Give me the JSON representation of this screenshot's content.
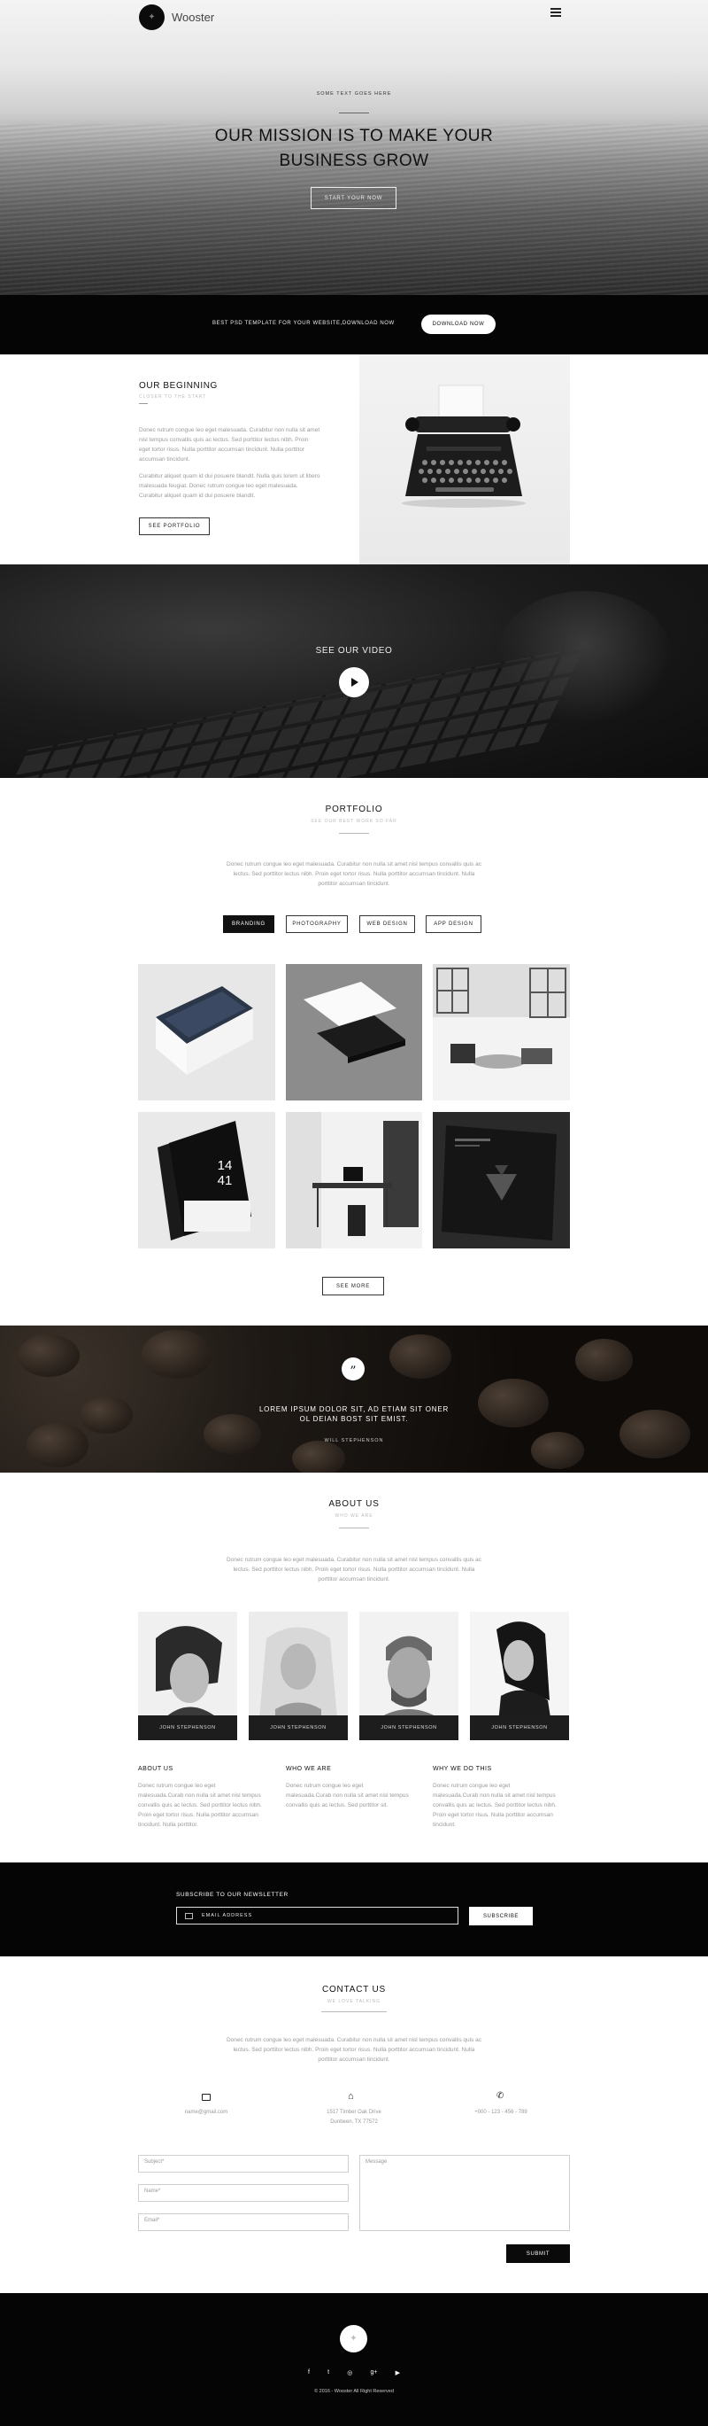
{
  "header": {
    "brand": "Wooster"
  },
  "hero": {
    "kicker": "SOME TEXT GOES HERE",
    "title_line1": "OUR MISSION IS TO MAKE YOUR",
    "title_line2": "BUSINESS GROW",
    "cta": "START YOUR NOW"
  },
  "promo": {
    "text": "BEST PSD TEMPLATE FOR YOUR WEBSITE,DOWNLOAD NOW",
    "button": "DOWNLOAD NOW"
  },
  "beginning": {
    "title": "OUR BEGINNING",
    "subtitle": "CLOSER TO THE START",
    "para1": "Donec rutrum congue leo eget malesuada. Curabitur non nulla sit amet nisl tempus convallis quis ac lectus. Sed porttitor lectus nibh. Proin eget tortor risus. Nulla porttitor accumsan tincidunt. Nulla porttitor accumsan tincidunt.",
    "para2": "Curabitur aliquet quam id dui posuere blandit. Nulla quis lorem ut libero malesuada feugiat. Donec rutrum congue leo eget malesuada. Curabitur aliquet quam id dui posuere blandit.",
    "button": "SEE PORTFOLIO"
  },
  "video": {
    "title": "SEE OUR VIDEO"
  },
  "portfolio": {
    "title": "PORTFOLIO",
    "subtitle": "SEE OUR BEST WORK SO FAR",
    "description": "Donec rutrum congue leo eget malesuada. Curabitur non nulla sit amet nisl tempus convallis quis ac lectus. Sed porttitor lectus nibh. Proin eget tortor risus. Nulla porttitor accumsan tincidunt. Nulla porttitor accumsan tincidunt.",
    "filters": [
      "BRANDING",
      "PHOTOGRAPHY",
      "WEB DESIGN",
      "APP DESIGN"
    ],
    "book_numbers": "14\n41",
    "more": "SEE MORE"
  },
  "quote": {
    "line1": "LOREM IPSUM DOLOR SIT, AD ETIAM SIT ONER",
    "line2": "OL DEIAN BOST SIT EMIST.",
    "author": "WILL STEPHENSON"
  },
  "about": {
    "title": "ABOUT US",
    "subtitle": "WHO WE ARE",
    "description": "Donec rutrum congue leo eget malesuada. Curabitur non nulla sit amet nisl tempus convallis quis ac lectus. Sed porttitor lectus nibh. Proin eget tortor risus. Nulla porttitor accumsan tincidunt. Nulla porttitor accumsan tincidunt.",
    "team": [
      "JOHN STEPHENSON",
      "JOHN STEPHENSON",
      "JOHN STEPHENSON",
      "JOHN STEPHENSON"
    ],
    "cols": [
      {
        "heading": "ABOUT US",
        "text": "Donec rutrum congue leo eget malesuada.Curab non nulla sit amet nisl tempus convallis quis ac lectus. Sed porttitor lectus nibh. Proin eget tortor risus. Nulla porttitor accumsan tincidunt. Nulla porttitor."
      },
      {
        "heading": "WHO WE ARE",
        "text": "Donec rutrum congue leo eget malesuada.Curab non nulla sit amet nisl tempus convallis quis ac lectus. Sed porttitor sit."
      },
      {
        "heading": "WHY WE DO THIS",
        "text": "Donec rutrum congue leo eget malesuada.Curab non nulla sit amet nisl tempus convallis quis ac lectus. Sed porttitor lectus nibh. Proin eget tortor risus. Nulla porttitor accumsan tincidunt."
      }
    ]
  },
  "newsletter": {
    "title": "SUBSCRIBE TO OUR NEWSLETTER",
    "placeholder": "EMAIL ADDRESS",
    "button": "SUBSCRIBE"
  },
  "contact": {
    "title": "CONTACT US",
    "subtitle": "WE LOVE TALKING",
    "description": "Donec rutrum congue leo eget malesuada. Curabitur non nulla sit amet nisl tempus convallis quis ac lectus. Sed porttitor lectus nibh. Proin eget tortor risus. Nulla porttitor accumsan tincidunt. Nulla porttitor accumsan tincidunt.",
    "email": "name@gmail.com",
    "address_line1": "1517 Timber Oak Drive",
    "address_line2": "Dunbeen, TX 77572",
    "phone": "+000 - 123 - 456 - 789",
    "subject_placeholder": "Subject*",
    "name_placeholder": "Name*",
    "email_placeholder": "Email*",
    "message_placeholder": "Message",
    "submit": "SUBMIT"
  },
  "footer": {
    "copyright": "© 2016 - Wooster All Right Reserved",
    "social_icons": [
      "facebook-icon",
      "twitter-icon",
      "dribbble-icon",
      "google-plus-icon",
      "youtube-icon"
    ]
  }
}
